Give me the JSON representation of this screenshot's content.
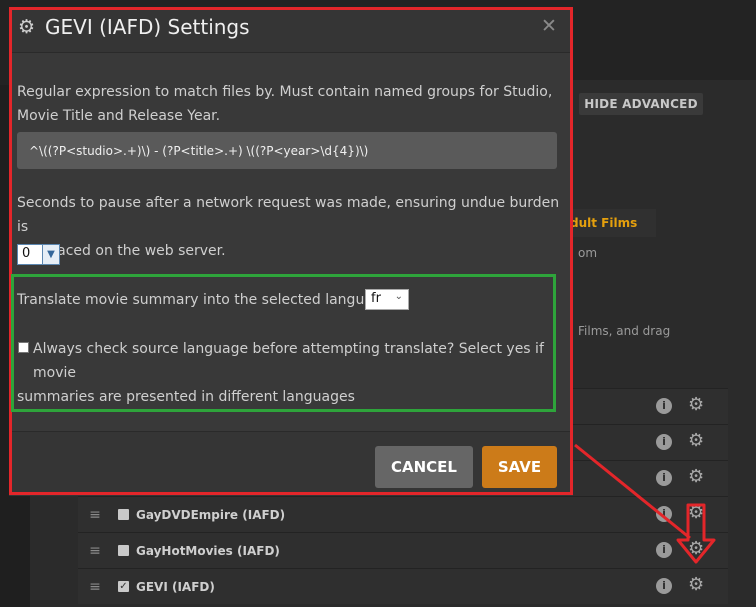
{
  "background": {
    "hide_advanced": "HIDE ADVANCED",
    "tab_label": "dult Films",
    "text_fragment_1": "om",
    "text_fragment_2": "Films, and drag",
    "agents": [
      {
        "name": "",
        "checked": false
      },
      {
        "name": "",
        "checked": false
      },
      {
        "name": "",
        "checked": false
      },
      {
        "name": "GayDVDEmpire (IAFD)",
        "checked": false
      },
      {
        "name": "GayHotMovies (IAFD)",
        "checked": false
      },
      {
        "name": "GEVI (IAFD)",
        "checked": true
      }
    ]
  },
  "modal": {
    "title": "GEVI (IAFD) Settings",
    "regex_label_line1": "Regular expression to match files by. Must contain named groups for Studio,",
    "regex_label_line2": "Movie Title and Release Year.",
    "regex_value": "^\\((?P<studio>.+)\\) - (?P<title>.+) \\((?P<year>\\d{4})\\)",
    "pause_label_line1": "Seconds to pause after a network request was made, ensuring undue burden is",
    "pause_label_line2": "not placed on the web server.",
    "pause_value": "0",
    "translate_label": "Translate movie summary into the selected language",
    "translate_value": "fr",
    "check_label_line1": "Always check source language before attempting translate? Select yes if movie",
    "check_label_line2": "summaries are presented in different languages",
    "cancel_label": "CANCEL",
    "save_label": "SAVE"
  },
  "colors": {
    "save_button": "#cc7b19",
    "annotation_red": "#e3262a",
    "annotation_green": "#2ea43b"
  }
}
